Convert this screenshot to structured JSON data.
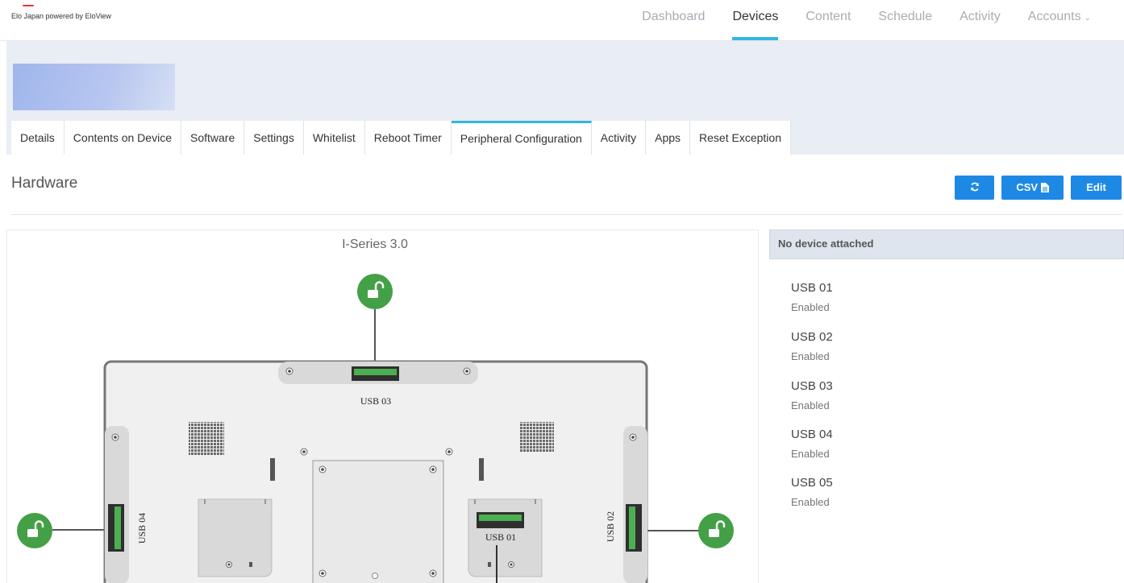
{
  "brand": {
    "text": "Elo Japan powered by EloView",
    "accent": "#e33333"
  },
  "nav": {
    "items": [
      "Dashboard",
      "Devices",
      "Content",
      "Schedule",
      "Activity",
      "Accounts"
    ],
    "active": "Devices",
    "accounts_icon": "chevron-down-icon"
  },
  "tabs": {
    "items": [
      "Details",
      "Contents on Device",
      "Software",
      "Settings",
      "Whitelist",
      "Reboot Timer",
      "Peripheral Configuration",
      "Activity",
      "Apps",
      "Reset Exception"
    ],
    "active": "Peripheral Configuration"
  },
  "section": {
    "title": "Hardware",
    "refresh_icon": "refresh-icon",
    "csv_label": "CSV",
    "csv_icon": "file-icon",
    "edit_label": "Edit"
  },
  "diagram": {
    "title": "I-Series 3.0",
    "labels": {
      "usb01": "USB 01",
      "usb02": "USB 02",
      "usb03": "USB 03",
      "usb04": "USB 04"
    },
    "lock_icon": "unlock-icon"
  },
  "side": {
    "header": "No device attached",
    "ports": [
      {
        "name": "USB 01",
        "status": "Enabled"
      },
      {
        "name": "USB 02",
        "status": "Enabled"
      },
      {
        "name": "USB 03",
        "status": "Enabled"
      },
      {
        "name": "USB 04",
        "status": "Enabled"
      },
      {
        "name": "USB 05",
        "status": "Enabled"
      }
    ]
  },
  "colors": {
    "accent": "#33b5e5",
    "button": "#1e88e5",
    "lock": "#43a047",
    "port": "#4caf50"
  }
}
